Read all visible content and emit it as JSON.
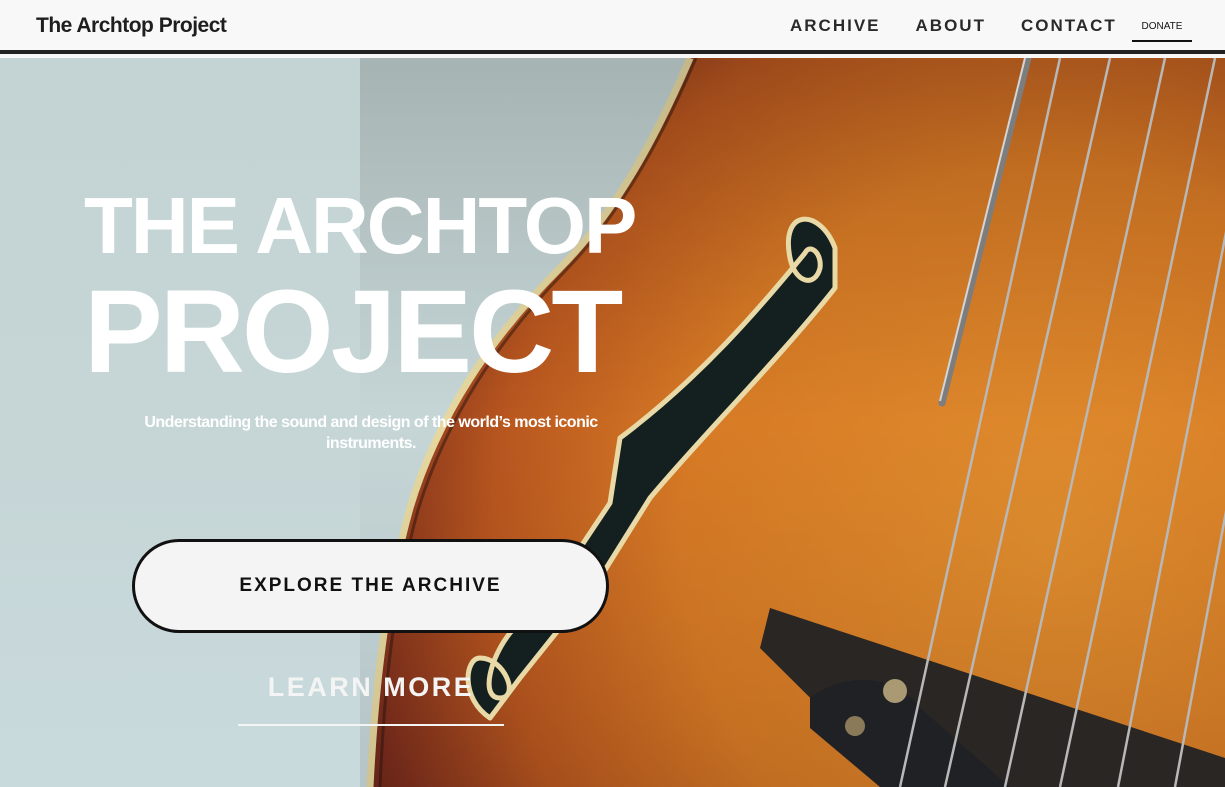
{
  "header": {
    "brand": "The Archtop Project",
    "nav": [
      {
        "label": "ARCHIVE"
      },
      {
        "label": "ABOUT"
      },
      {
        "label": "CONTACT"
      }
    ],
    "donate_label": "DONATE"
  },
  "hero": {
    "title_line1": "THE ARCHTOP",
    "title_line2": "PROJECT",
    "subtitle": "Understanding the sound and design of the world’s most iconic instruments.",
    "primary_button": "EXPLORE THE ARCHIVE",
    "secondary_link": "LEARN MORE",
    "background_image": "archtop-guitar-photo"
  },
  "colors": {
    "sky": "#c4d3d3",
    "guitar_orange": "#d9822a",
    "guitar_dark": "#4a1a14",
    "binding": "#e8d9a6",
    "text_on_hero": "#ffffff",
    "header_bg": "#f8f8f8"
  }
}
